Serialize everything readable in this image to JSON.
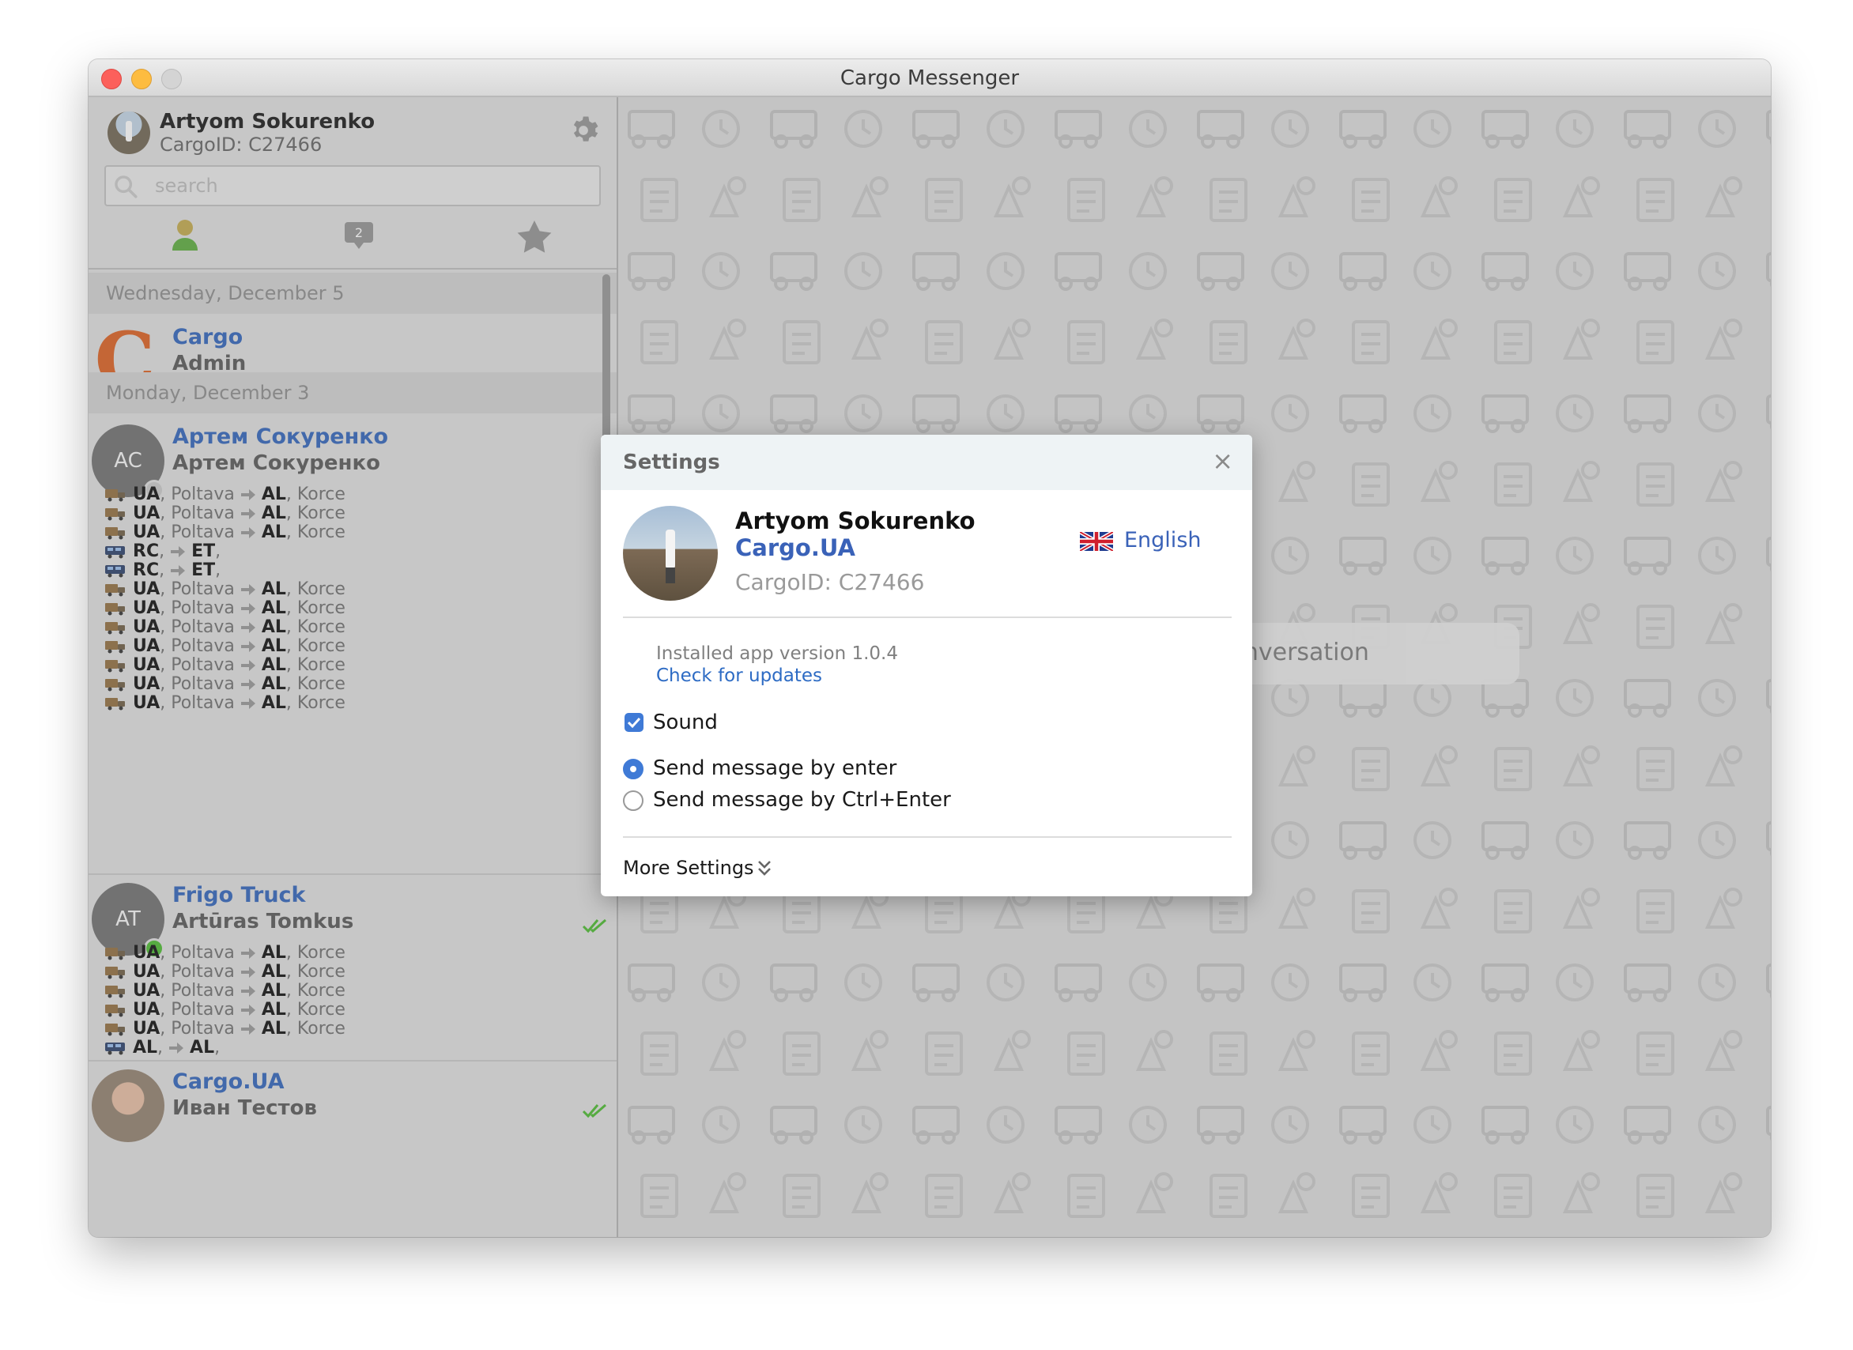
{
  "window": {
    "title": "Cargo Messenger"
  },
  "profile": {
    "name": "Artyom Sokurenko",
    "cargo_id": "CargoID: C27466"
  },
  "search": {
    "placeholder": "search"
  },
  "tabs": {
    "chats_badge": "2"
  },
  "chat_list": {
    "dates": [
      "Wednesday, December 5",
      "Monday, December 3"
    ],
    "conversations": [
      {
        "title": "Cargo",
        "subtitle": "Admin",
        "logo_letter": "C"
      },
      {
        "title": "Артем Сокуренко",
        "subtitle": "Артем Сокуренко",
        "initials": "AC"
      },
      {
        "title": "Frigo Truck",
        "subtitle": "Artūras Tomkus",
        "initials": "AT"
      },
      {
        "title": "Cargo.UA",
        "subtitle": "Иван Тестов"
      }
    ],
    "routes_a": [
      {
        "vehicle": "truck",
        "from": "UA",
        "from_city": ", Poltava",
        "to": "AL",
        "to_city": ", Korce"
      },
      {
        "vehicle": "truck",
        "from": "UA",
        "from_city": ", Poltava",
        "to": "AL",
        "to_city": ", Korce"
      },
      {
        "vehicle": "truck",
        "from": "UA",
        "from_city": ", Poltava",
        "to": "AL",
        "to_city": ", Korce"
      },
      {
        "vehicle": "bus",
        "from": "RC",
        "from_city": ",",
        "to": "ET",
        "to_city": ","
      },
      {
        "vehicle": "bus",
        "from": "RC",
        "from_city": ",",
        "to": "ET",
        "to_city": ","
      },
      {
        "vehicle": "truck",
        "from": "UA",
        "from_city": ", Poltava",
        "to": "AL",
        "to_city": ", Korce"
      },
      {
        "vehicle": "truck",
        "from": "UA",
        "from_city": ", Poltava",
        "to": "AL",
        "to_city": ", Korce"
      },
      {
        "vehicle": "truck",
        "from": "UA",
        "from_city": ", Poltava",
        "to": "AL",
        "to_city": ", Korce"
      },
      {
        "vehicle": "truck",
        "from": "UA",
        "from_city": ", Poltava",
        "to": "AL",
        "to_city": ", Korce"
      },
      {
        "vehicle": "truck",
        "from": "UA",
        "from_city": ", Poltava",
        "to": "AL",
        "to_city": ", Korce"
      },
      {
        "vehicle": "truck",
        "from": "UA",
        "from_city": ", Poltava",
        "to": "AL",
        "to_city": ", Korce"
      },
      {
        "vehicle": "truck",
        "from": "UA",
        "from_city": ", Poltava",
        "to": "AL",
        "to_city": ", Korce"
      }
    ],
    "routes_b": [
      {
        "vehicle": "truck",
        "from": "UA",
        "from_city": ", Poltava",
        "to": "AL",
        "to_city": ", Korce"
      },
      {
        "vehicle": "truck",
        "from": "UA",
        "from_city": ", Poltava",
        "to": "AL",
        "to_city": ", Korce"
      },
      {
        "vehicle": "truck",
        "from": "UA",
        "from_city": ", Poltava",
        "to": "AL",
        "to_city": ", Korce"
      },
      {
        "vehicle": "truck",
        "from": "UA",
        "from_city": ", Poltava",
        "to": "AL",
        "to_city": ", Korce"
      },
      {
        "vehicle": "truck",
        "from": "UA",
        "from_city": ", Poltava",
        "to": "AL",
        "to_city": ", Korce"
      },
      {
        "vehicle": "bus",
        "from": "AL",
        "from_city": ",",
        "to": "AL",
        "to_city": ","
      }
    ]
  },
  "main": {
    "placeholder_text": "conversation"
  },
  "settings": {
    "title": "Settings",
    "close": "×",
    "name": "Artyom Sokurenko",
    "company": "Cargo.UA",
    "cargo_id": "CargoID: C27466",
    "language": "English",
    "version_text": "Installed app version 1.0.4",
    "check_updates": "Check for updates",
    "sound_label": "Sound",
    "sound_checked": true,
    "send_options": [
      "Send message by enter",
      "Send message by Ctrl+Enter"
    ],
    "send_selected": "Send message by enter",
    "more_settings": "More Settings"
  },
  "colors": {
    "accent": "#3f7ad6",
    "link": "#3a62b8",
    "online": "#48b02f",
    "cargo_logo": "#cf5c21"
  }
}
